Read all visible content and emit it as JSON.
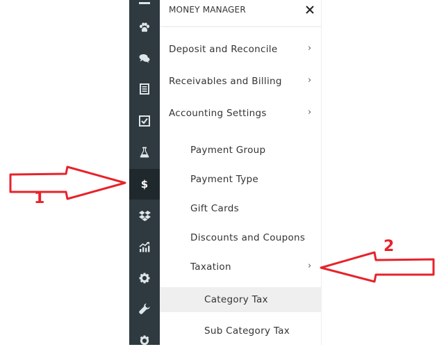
{
  "panel": {
    "title": "MONEY MANAGER",
    "close_icon": "close-icon"
  },
  "rail": {
    "items": [
      {
        "icon": "menu-icon"
      },
      {
        "icon": "paw-icon"
      },
      {
        "icon": "chat-icon"
      },
      {
        "icon": "receipt-icon"
      },
      {
        "icon": "checkbox-icon"
      },
      {
        "icon": "flask-icon"
      },
      {
        "icon": "dollar-icon",
        "glyph": "$",
        "active": true
      },
      {
        "icon": "dropbox-icon"
      },
      {
        "icon": "chart-icon"
      },
      {
        "icon": "gear-icon"
      },
      {
        "icon": "wrench-icon"
      },
      {
        "icon": "settings-icon"
      }
    ]
  },
  "menu": {
    "deposit": "Deposit and Reconcile",
    "receivables": "Receivables and Billing",
    "accounting": "Accounting Settings",
    "payment_group": "Payment Group",
    "payment_type": "Payment Type",
    "gift_cards": "Gift Cards",
    "discounts": "Discounts and Coupons",
    "taxation": "Taxation",
    "category_tax": "Category Tax",
    "sub_category_tax": "Sub Category Tax",
    "chevron": "›"
  },
  "annotations": {
    "label_1": "1",
    "label_2": "2",
    "color": "#e8222a"
  }
}
